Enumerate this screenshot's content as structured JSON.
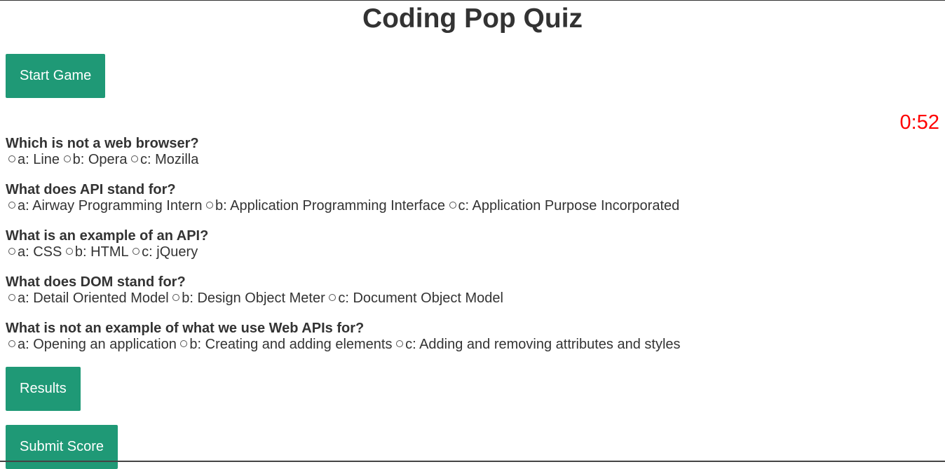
{
  "header": {
    "title": "Coding Pop Quiz"
  },
  "controls": {
    "start_label": "Start Game",
    "results_label": "Results",
    "submit_label": "Submit Score"
  },
  "timer": {
    "value": "0:52"
  },
  "questions": [
    {
      "text": "Which is not a web browser?",
      "options": [
        "a: Line",
        "b: Opera",
        "c: Mozilla"
      ]
    },
    {
      "text": "What does API stand for?",
      "options": [
        "a: Airway Programming Intern",
        "b: Application Programming Interface",
        "c: Application Purpose Incorporated"
      ]
    },
    {
      "text": "What is an example of an API?",
      "options": [
        "a: CSS",
        "b: HTML",
        "c: jQuery"
      ]
    },
    {
      "text": "What does DOM stand for?",
      "options": [
        "a: Detail Oriented Model",
        "b: Design Object Meter",
        "c: Document Object Model"
      ]
    },
    {
      "text": "What is not an example of what we use Web APIs for?",
      "options": [
        "a: Opening an application",
        "b: Creating and adding elements",
        "c: Adding and removing attributes and styles"
      ]
    }
  ],
  "colors": {
    "button_bg": "#1f9976",
    "button_text": "#ffffff",
    "timer": "#ff0000",
    "text": "#333333"
  }
}
